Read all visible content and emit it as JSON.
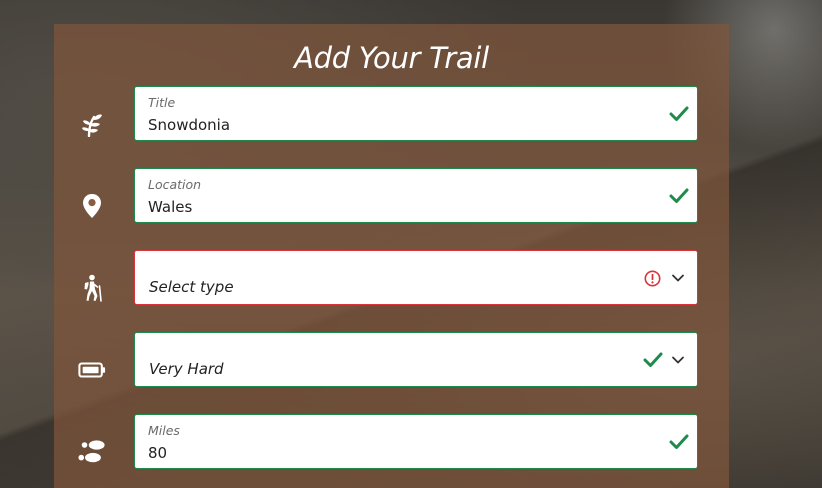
{
  "form": {
    "title": "Add Your Trail",
    "fields": [
      {
        "name": "title",
        "label": "Title",
        "value": "Snowdonia",
        "icon": "leaf-icon",
        "state": "valid"
      },
      {
        "name": "location",
        "label": "Location",
        "value": "Wales",
        "icon": "map-pin-icon",
        "state": "valid"
      },
      {
        "name": "type",
        "label": "",
        "value": "Select type",
        "icon": "hiker-icon",
        "state": "error"
      },
      {
        "name": "difficulty",
        "label": "",
        "value": "Very Hard",
        "icon": "battery-icon",
        "state": "valid"
      },
      {
        "name": "miles",
        "label": "Miles",
        "value": "80",
        "icon": "footprints-icon",
        "state": "valid"
      }
    ]
  },
  "colors": {
    "valid": "#1e8a4c",
    "error": "#d9343b",
    "panel": "#80563c",
    "icon": "#ffffff"
  }
}
